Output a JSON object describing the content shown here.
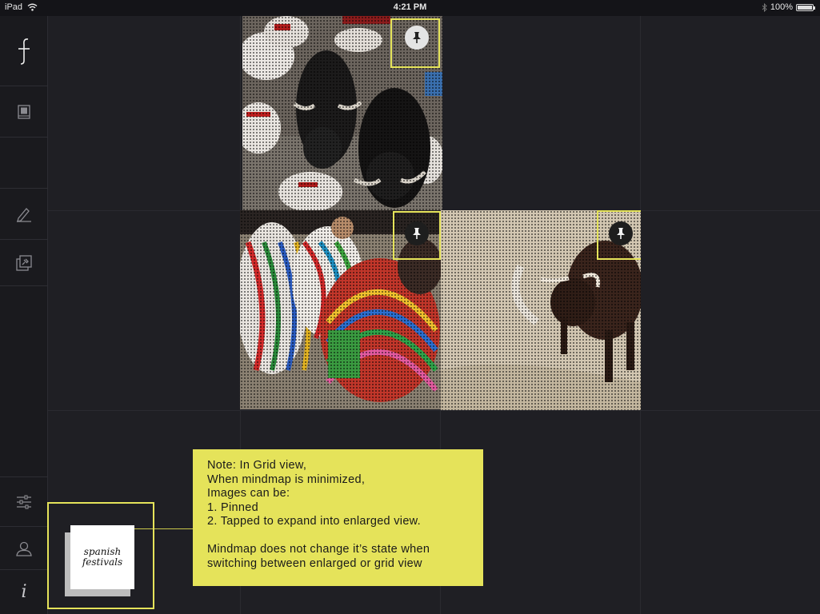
{
  "status_bar": {
    "device": "iPad",
    "time": "4:21 PM",
    "battery": "100%",
    "battery_level": 1.0
  },
  "sidebar": {
    "items": [
      {
        "icon": "logo-icon"
      },
      {
        "icon": "book-icon"
      },
      {
        "icon": "blank"
      },
      {
        "icon": "pencil-icon"
      },
      {
        "icon": "pinned-stack-icon"
      },
      {
        "icon": "sliders-icon"
      },
      {
        "icon": "user-icon"
      },
      {
        "icon": "info-icon"
      }
    ],
    "info_glyph": "i"
  },
  "tiles": [
    {
      "name": "running-of-bulls",
      "pinned": false
    },
    {
      "name": "flamenco-dancers",
      "pinned": true
    },
    {
      "name": "bull-arena",
      "pinned": true
    }
  ],
  "note": {
    "text": "Note: In Grid view,\nWhen mindmap is minimized,\nImages can be:\n1. Pinned\n2. Tapped to expand into enlarged view.\n\nMindmap does not change it’s state when\nswitching between enlarged or grid view"
  },
  "mindmap": {
    "label_line1": "spanish",
    "label_line2": "festivals"
  },
  "colors": {
    "accent": "#e5e35a",
    "background": "#1f1f24",
    "sidebar": "#1a1a1e"
  }
}
